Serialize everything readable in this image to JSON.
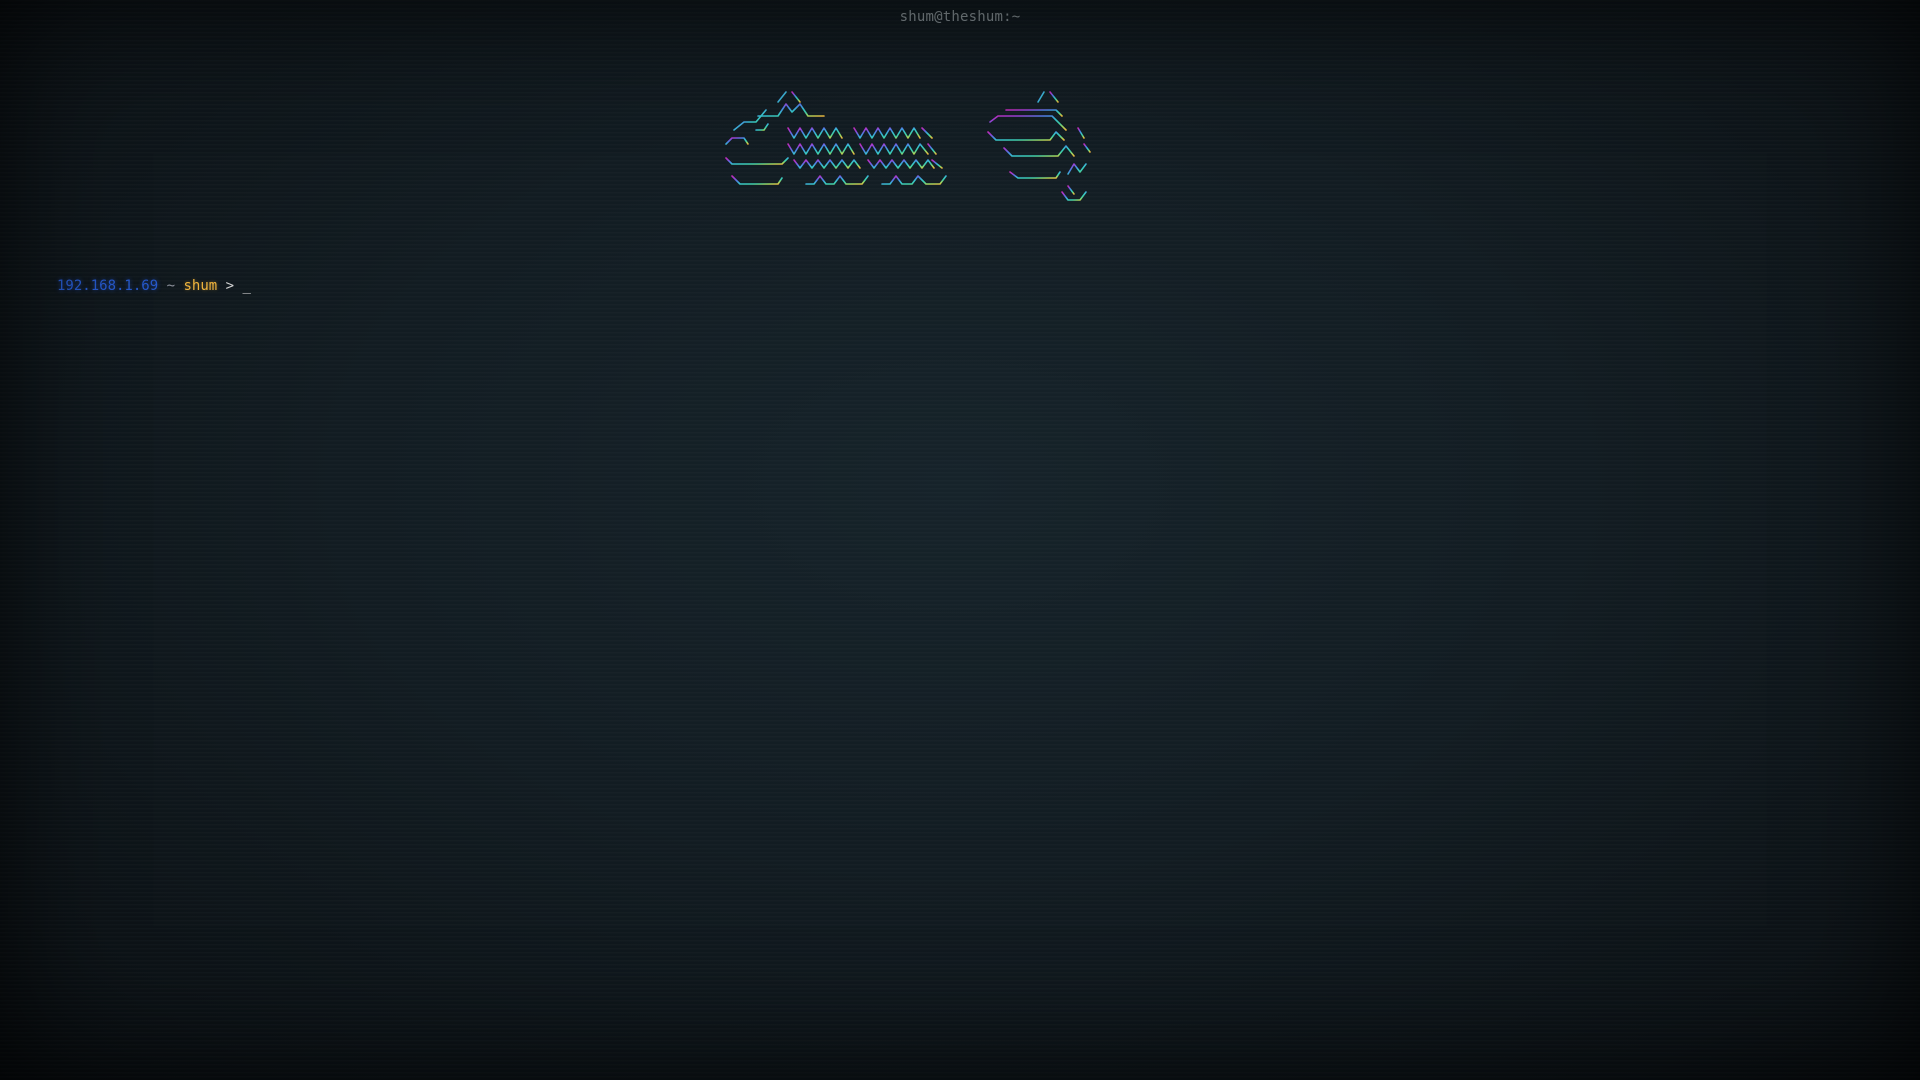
{
  "window": {
    "title": "shum@theshum:~"
  },
  "banner": {
    "logo_text": "Shum",
    "palette": [
      "#b02cc4",
      "#9a3fd6",
      "#6b5ee8",
      "#4c7fe6",
      "#3ea6e0",
      "#35c2cf",
      "#3fd0a8",
      "#6fd97a",
      "#b8d85a",
      "#f0b43c"
    ]
  },
  "prompt": {
    "ip": "192.168.1.69",
    "tilde": "~",
    "user": "shum",
    "arrow": ">",
    "cursor": "_"
  },
  "colors": {
    "background": "#111a1f",
    "ip": "#2457c9",
    "user": "#f0b43c",
    "title": "#8a9499"
  }
}
